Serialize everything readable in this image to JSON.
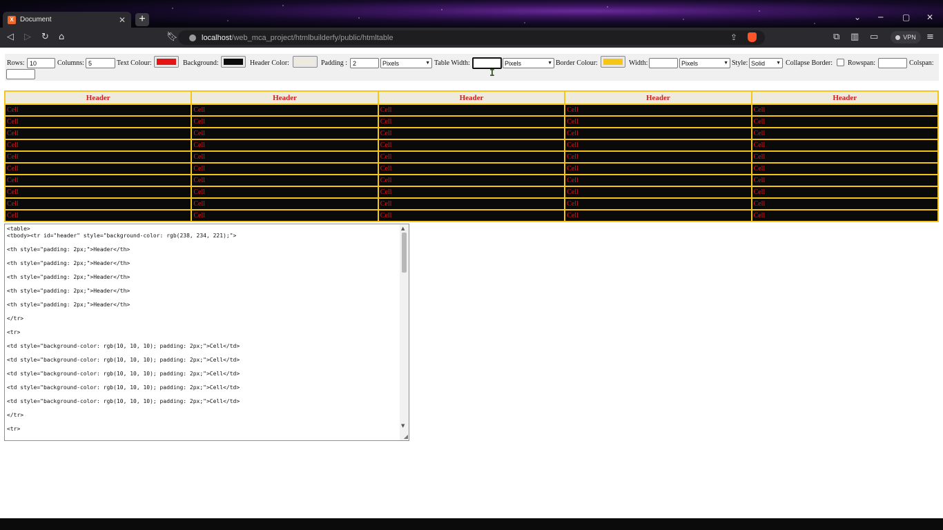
{
  "browser": {
    "tab_title": "Document",
    "favicon_letter": "X",
    "new_tab": "+",
    "url_host": "localhost",
    "url_path": "/web_mca_project/htmlbuilderfy/public/htmltable",
    "vpn_label": "VPN"
  },
  "icons": {
    "back": "arrow-left-icon",
    "forward": "arrow-right-icon",
    "reload": "reload-icon",
    "home": "home-icon",
    "bookmark": "bookmark-icon",
    "share": "share-icon",
    "shield": "brave-shield-icon",
    "extensions": "puzzle-icon",
    "sidebar": "sidebar-icon",
    "wallet": "wallet-icon",
    "menu": "hamburger-menu-icon"
  },
  "controls": {
    "rows_label": "Rows:",
    "rows_value": "10",
    "columns_label": "Columns:",
    "columns_value": "5",
    "text_colour_label": "Text Colour:",
    "text_colour": "#e41414",
    "background_label": "Background:",
    "background_colour": "#0a0a0a",
    "header_color_label": "Header Color:",
    "header_colour": "#eeeadd",
    "padding_label": "Padding :",
    "padding_value": "2",
    "padding_unit": "Pixels",
    "table_width_label": "Table Width:",
    "table_width_value": "",
    "table_width_unit": "Pixels",
    "border_colour_label": "Border Colour:",
    "border_colour": "#f5c518",
    "width_label": "Width:",
    "width_value": "",
    "width_unit": "Pixels",
    "style_label": "Style:",
    "style_value": "Solid",
    "collapse_border_label": "Collapse Border:",
    "rowspan_label": "Rowspan:",
    "rowspan_value": "",
    "colspan_label": "Colspan:",
    "colspan_value": ""
  },
  "table": {
    "headers": [
      "Header",
      "Header",
      "Header",
      "Header",
      "Header"
    ],
    "rows": [
      [
        "Cell",
        "Cell",
        "Cell",
        "Cell",
        "Cell"
      ],
      [
        "Cell",
        "Cell",
        "Cell",
        "Cell",
        "Cell"
      ],
      [
        "Cell",
        "Cell",
        "Cell",
        "Cell",
        "Cell"
      ],
      [
        "Cell",
        "Cell",
        "Cell",
        "Cell",
        "Cell"
      ],
      [
        "Cell",
        "Cell",
        "Cell",
        "Cell",
        "Cell"
      ],
      [
        "Cell",
        "Cell",
        "Cell",
        "Cell",
        "Cell"
      ],
      [
        "Cell",
        "Cell",
        "Cell",
        "Cell",
        "Cell"
      ],
      [
        "Cell",
        "Cell",
        "Cell",
        "Cell",
        "Cell"
      ],
      [
        "Cell",
        "Cell",
        "Cell",
        "Cell",
        "Cell"
      ],
      [
        "Cell",
        "Cell",
        "Cell",
        "Cell",
        "Cell"
      ]
    ]
  },
  "code_lines": [
    "<table>",
    "<tbody><tr id=\"header\" style=\"background-color: rgb(238, 234, 221);\">",
    "",
    "<th style=\"padding: 2px;\">Header</th>",
    "",
    "<th style=\"padding: 2px;\">Header</th>",
    "",
    "<th style=\"padding: 2px;\">Header</th>",
    "",
    "<th style=\"padding: 2px;\">Header</th>",
    "",
    "<th style=\"padding: 2px;\">Header</th>",
    "",
    "</tr>",
    "",
    "<tr>",
    "",
    "<td style=\"background-color: rgb(10, 10, 10); padding: 2px;\">Cell</td>",
    "",
    "<td style=\"background-color: rgb(10, 10, 10); padding: 2px;\">Cell</td>",
    "",
    "<td style=\"background-color: rgb(10, 10, 10); padding: 2px;\">Cell</td>",
    "",
    "<td style=\"background-color: rgb(10, 10, 10); padding: 2px;\">Cell</td>",
    "",
    "<td style=\"background-color: rgb(10, 10, 10); padding: 2px;\">Cell</td>",
    "",
    "</tr>",
    "",
    "<tr>"
  ]
}
